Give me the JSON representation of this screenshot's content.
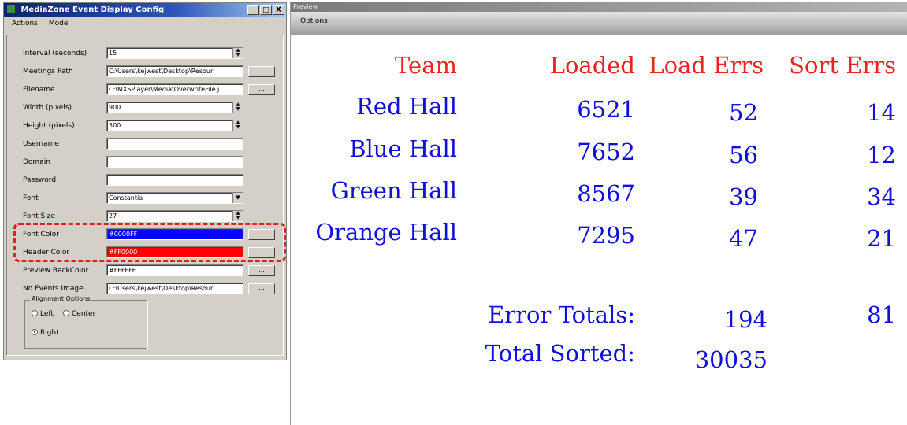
{
  "config_window": {
    "title": "MediaZone Event Display Config",
    "controls": {
      "minimize": "_",
      "maximize": "□",
      "close": "X"
    },
    "menu": [
      "Actions",
      "Mode"
    ],
    "fields": {
      "interval": {
        "label": "Interval (seconds)",
        "value": "15"
      },
      "meetings_path": {
        "label": "Meetings Path",
        "value": "C:\\Users\\kejwest\\Desktop\\Resour"
      },
      "filename": {
        "label": "Filename",
        "value": "C:\\MXSPlayer\\Media\\OverwriteFile.j"
      },
      "width": {
        "label": "Width (pixels)",
        "value": "900"
      },
      "height": {
        "label": "Height (pixels)",
        "value": "500"
      },
      "username": {
        "label": "Username",
        "value": ""
      },
      "domain": {
        "label": "Domain",
        "value": ""
      },
      "password": {
        "label": "Password",
        "value": ""
      },
      "font": {
        "label": "Font",
        "value": "Constantia"
      },
      "font_size": {
        "label": "Font Size",
        "value": "27"
      },
      "font_color": {
        "label": "Font Color",
        "value": "#0000FF"
      },
      "header_color": {
        "label": "Header Color",
        "value": "#FF0000"
      },
      "preview_back": {
        "label": "Preview BackColor",
        "value": "#FFFFFF"
      },
      "no_events_image": {
        "label": "No Events Image",
        "value": "C:\\Users\\kejwest\\Desktop\\Resour"
      }
    },
    "browse_label": "...",
    "alignment": {
      "title": "Alignment Options",
      "options": [
        "Left",
        "Center",
        "Right"
      ],
      "selected": "Right"
    },
    "colors": {
      "font_color_swatch": "#0000ff",
      "header_color_swatch": "#ff0000",
      "highlight": "#e02020"
    }
  },
  "preview_window": {
    "title": "Preview",
    "menu": [
      "Options"
    ],
    "headers": [
      "Team",
      "Loaded",
      "Load Errs",
      "Sort Errs"
    ],
    "rows": [
      [
        "Red Hall",
        "6521",
        "52",
        "14"
      ],
      [
        "Blue Hall",
        "7652",
        "56",
        "12"
      ],
      [
        "Green Hall",
        "8567",
        "39",
        "34"
      ],
      [
        "Orange Hall",
        "7295",
        "47",
        "21"
      ]
    ],
    "error_totals": {
      "label": "Error Totals:",
      "load_errs": "194",
      "sort_errs": "81"
    },
    "total_sorted": {
      "label": "Total Sorted:",
      "value": "30035"
    },
    "colors": {
      "header": "#ee2222",
      "data": "#1010dd"
    }
  }
}
